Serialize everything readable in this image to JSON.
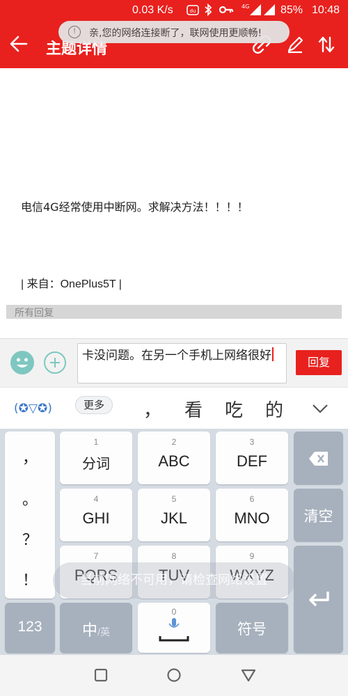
{
  "status_bar": {
    "speed": "0.03 K/s",
    "battery": "85%",
    "time": "10:48",
    "network_tag": "4G"
  },
  "app_bar": {
    "title": "主题详情",
    "back_icon": "arrow-left-icon",
    "actions": [
      "link-icon",
      "pen-icon",
      "sort-icon"
    ]
  },
  "toast": {
    "text": "亲,您的网络连接断了，联网使用更顺畅!",
    "icon": "info-icon"
  },
  "post": {
    "body": "电信4G经常使用中断网。求解决方法！！！！",
    "source": "| 来自：OnePlus5T |"
  },
  "replies_header": "所有回复",
  "reply_bar": {
    "input_value": "卡没问题。在另一个手机上网络很好",
    "submit_label": "回复",
    "accent": "#e8211e"
  },
  "ime": {
    "logo": "(✪▽✪)",
    "more_label": "更多",
    "candidates": [
      "，",
      "看",
      "吃",
      "的"
    ],
    "punctuation": [
      "，",
      "。",
      "？",
      "！"
    ],
    "keys": [
      {
        "num": "1",
        "label": "分词"
      },
      {
        "num": "2",
        "label": "ABC"
      },
      {
        "num": "3",
        "label": "DEF"
      },
      {
        "num": "4",
        "label": "GHI"
      },
      {
        "num": "5",
        "label": "JKL"
      },
      {
        "num": "6",
        "label": "MNO"
      },
      {
        "num": "7",
        "label": "PQRS"
      },
      {
        "num": "8",
        "label": "TUV"
      },
      {
        "num": "9",
        "label": "WXYZ"
      }
    ],
    "clear_label": "清空",
    "mode_123": "123",
    "lang_cn": "中",
    "lang_en": "/英",
    "space_num": "0",
    "symbols_label": "符号",
    "network_hint": "当前网络不可用，请检查网络设置"
  }
}
